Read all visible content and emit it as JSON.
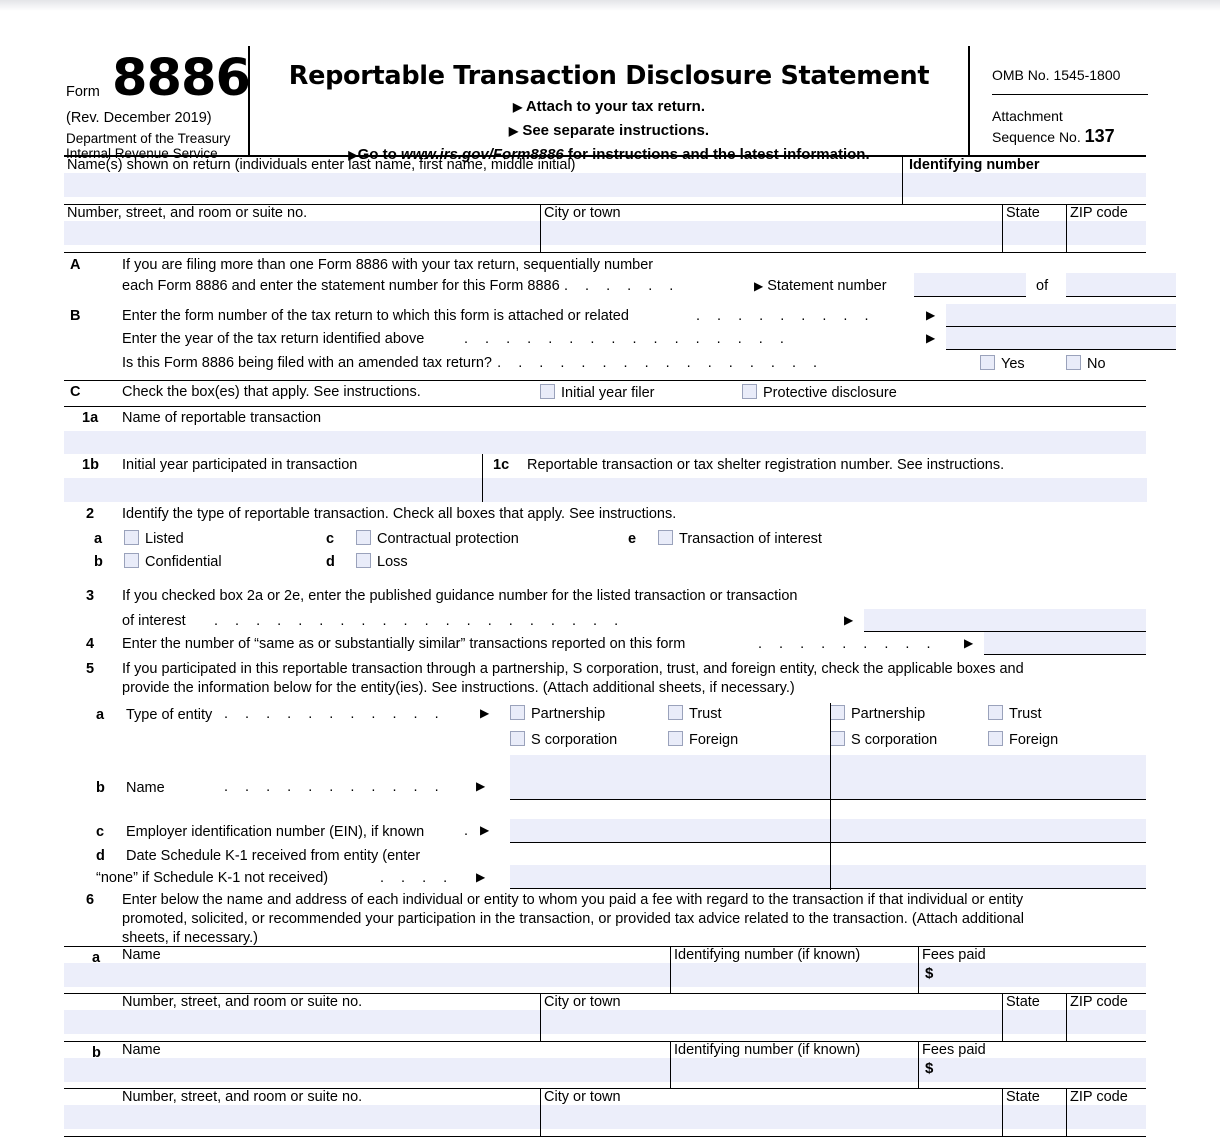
{
  "header": {
    "form_word": "Form",
    "form_number": "8886",
    "revision": "(Rev. December 2019)",
    "dept_line1": "Department of the Treasury",
    "dept_line2": "Internal Revenue Service",
    "title": "Reportable Transaction Disclosure Statement",
    "sub1": "Attach to your tax return.",
    "sub2": "See separate instructions.",
    "sub3_pre": "Go to ",
    "sub3_url": "www.irs.gov/Form8886",
    "sub3_post": " for instructions and the latest information.",
    "omb": "OMB No. 1545-1800",
    "attachment_label": "Attachment",
    "sequence_label": "Sequence No.",
    "sequence_number": "137"
  },
  "identity": {
    "names_caption": "Name(s) shown on return (individuals enter last name, first name, middle initial)",
    "identifying_number_caption": "Identifying number",
    "street_caption": "Number, street, and room or suite no.",
    "city_caption": "City or town",
    "state_caption": "State",
    "zip_caption": "ZIP code",
    "names_value": "",
    "identifying_number_value": "",
    "street_value": "",
    "city_value": "",
    "state_value": "",
    "zip_value": ""
  },
  "section_a": {
    "letter": "A",
    "line1": "If you are filing more than one Form 8886 with your tax return, sequentially number",
    "line2": "each Form 8886 and enter the statement number for this Form 8886",
    "leader": ". . . . . .",
    "triangle": "▶",
    "statement_number_label": "Statement number",
    "statement_number_value": "",
    "of_label": "of",
    "of_value": ""
  },
  "section_b": {
    "letter": "B",
    "line1": "Enter the form number of the tax return to which this form is attached or related",
    "line1_leader": ". . . . . . . . .",
    "line1_value": "",
    "line2": "Enter the year of the tax return identified above",
    "line2_leader": ". . . . . . . . . . . . . . . .",
    "line2_value": "",
    "line3": "Is this Form 8886 being filed with an amended tax return?",
    "line3_leader": ". . . . . . . . . . . . . . . . . . .",
    "yes_label": "Yes",
    "no_label": "No",
    "yes_checked": false,
    "no_checked": false,
    "triangle": "▶"
  },
  "section_c": {
    "letter": "C",
    "text": "Check the box(es) that apply. See instructions.",
    "boxes": [
      {
        "label": "Initial year filer",
        "checked": false
      },
      {
        "label": "Protective disclosure",
        "checked": false
      }
    ]
  },
  "line_1a": {
    "number": "1a",
    "caption": "Name of reportable transaction",
    "value": ""
  },
  "line_1b": {
    "number": "1b",
    "caption": "Initial year participated in transaction",
    "value": ""
  },
  "line_1c": {
    "number": "1c",
    "caption": "Reportable transaction or tax shelter registration number. See instructions.",
    "value": ""
  },
  "line_2": {
    "number": "2",
    "caption": "Identify the type of reportable transaction. Check all boxes that apply. See instructions.",
    "options": [
      {
        "letter": "a",
        "label": "Listed",
        "checked": false
      },
      {
        "letter": "b",
        "label": "Confidential",
        "checked": false
      },
      {
        "letter": "c",
        "label": "Contractual protection",
        "checked": false
      },
      {
        "letter": "d",
        "label": "Loss",
        "checked": false
      },
      {
        "letter": "e",
        "label": "Transaction of interest",
        "checked": false
      }
    ]
  },
  "line_3": {
    "number": "3",
    "text1": "If you checked box 2a or 2e, enter the published guidance number for the listed transaction or transaction",
    "text2": "of interest",
    "leader": ". . . . . . . . . . . . . . . . . . . .",
    "triangle": "▶",
    "value": ""
  },
  "line_4": {
    "number": "4",
    "text": "Enter the number of “same as or substantially similar” transactions reported on this form",
    "leader": ". . . . . . . . .",
    "triangle": "▶",
    "value": ""
  },
  "line_5": {
    "number": "5",
    "text1": "If you participated in this reportable transaction through a partnership, S corporation, trust, and foreign entity, check the applicable boxes and",
    "text2": "provide the information below for the entity(ies). See instructions. (Attach additional sheets, if necessary.)",
    "triangle": "▶",
    "a": {
      "letter": "a",
      "label": "Type of entity",
      "leader": ". . . . . . . . . . .",
      "entity_types": [
        "Partnership",
        "Trust",
        "S corporation",
        "Foreign"
      ],
      "col1_checked": [
        false,
        false,
        false,
        false
      ],
      "col2_checked": [
        false,
        false,
        false,
        false
      ]
    },
    "b": {
      "letter": "b",
      "label": "Name",
      "leader": ". . . . . . . . . . .",
      "col1_value": "",
      "col2_value": ""
    },
    "c": {
      "letter": "c",
      "label": "Employer identification number (EIN), if known",
      "leader": ".",
      "col1_value": "",
      "col2_value": ""
    },
    "d": {
      "letter": "d",
      "label_line1": "Date Schedule K-1 received from entity (enter",
      "label_line2": "“none” if Schedule K-1 not received)",
      "leader": ". . . .",
      "col1_value": "",
      "col2_value": ""
    }
  },
  "line_6": {
    "number": "6",
    "text1": "Enter below the name and address of each individual or entity to whom you paid a fee with regard to the transaction if that individual or entity",
    "text2": "promoted, solicited, or recommended your participation in the transaction, or provided tax advice related to the transaction. (Attach additional",
    "text3": "sheets, if necessary.)",
    "name_caption": "Name",
    "identifying_caption": "Identifying number (if known)",
    "fees_caption": "Fees paid",
    "dollar_sign": "$",
    "street_caption": "Number, street, and room or suite no.",
    "city_caption": "City or town",
    "state_caption": "State",
    "zip_caption": "ZIP code",
    "entries": [
      {
        "letter": "a",
        "name": "",
        "identifying": "",
        "fees": "",
        "street": "",
        "city": "",
        "state": "",
        "zip": ""
      },
      {
        "letter": "b",
        "name": "",
        "identifying": "",
        "fees": "",
        "street": "",
        "city": "",
        "state": "",
        "zip": ""
      }
    ]
  },
  "colors": {
    "field_fill": "#eceefa",
    "checkbox_fill": "#e9ecf9",
    "checkbox_border": "#9aa2bb",
    "rule": "#000000"
  }
}
